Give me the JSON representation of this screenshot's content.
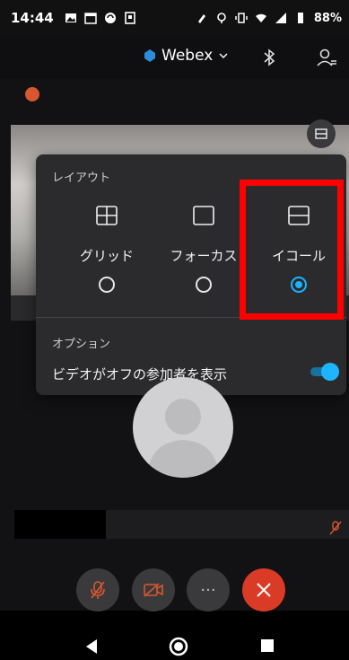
{
  "status_bar": {
    "time": "14:44",
    "left_icons": [
      "image-icon",
      "calendar-icon",
      "sync-icon",
      "box-icon"
    ],
    "right_icons": [
      "nfc-icon",
      "location-icon",
      "vibrate-icon",
      "wifi-icon",
      "signal-icon",
      "battery-icon"
    ],
    "battery": "88%"
  },
  "header": {
    "brand": "Webex",
    "brand_icon": "webex-logo-icon",
    "dropdown_icon": "chevron-down-icon",
    "bluetooth_icon": "bluetooth-icon",
    "participants_icon": "participants-icon"
  },
  "layout_panel": {
    "title": "レイアウト",
    "options": [
      {
        "label": "グリッド",
        "icon": "grid-layout-icon",
        "selected": false
      },
      {
        "label": "フォーカス",
        "icon": "focus-layout-icon",
        "selected": false
      },
      {
        "label": "イコール",
        "icon": "equal-layout-icon",
        "selected": true
      }
    ],
    "options_title": "オプション",
    "show_video_off_label": "ビデオがオフの参加者を表示",
    "show_video_off_enabled": true
  },
  "controls": {
    "mute_icon": "mic-muted-icon",
    "video_icon": "video-off-icon",
    "more_label": "···",
    "end_icon": "close-icon"
  },
  "colors": {
    "accent": "#19b3ff",
    "end_call": "#d93b26",
    "highlight": "#ff0000",
    "panel_bg": "#2b2b2e"
  }
}
